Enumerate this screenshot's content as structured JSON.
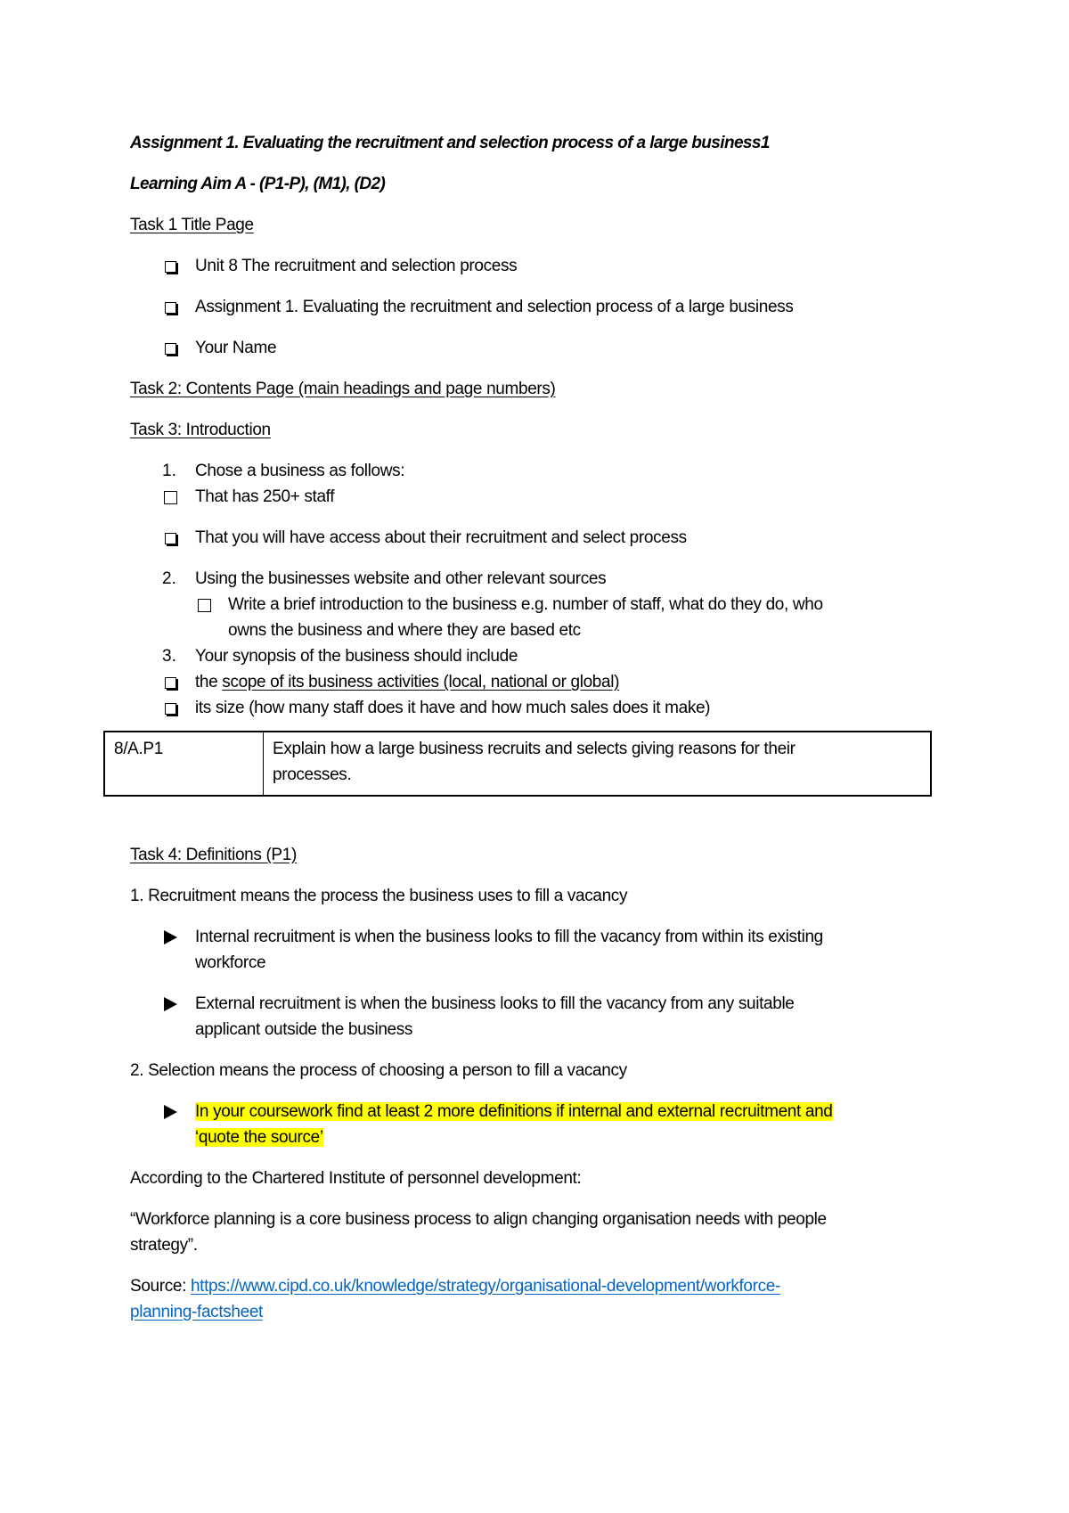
{
  "document": {
    "title": "Assignment 1.  Evaluating the recruitment and selection process of a large business1",
    "learning_aim": "Learning Aim A - (P1-P), (M1), (D2)",
    "task1": {
      "heading": "Task 1 Title Page ",
      "items": [
        "Unit 8 The recruitment and selection process",
        "Assignment 1.  Evaluating the recruitment and selection process of a large business",
        "Your Name"
      ]
    },
    "task2": {
      "heading": "Task 2: Contents Page (main headings and page numbers) "
    },
    "task3": {
      "heading": "Task 3: Introduction ",
      "step1_number": "1.",
      "step1_text": "Chose a business as follows:",
      "step1_items": [
        "That has 250+ staff",
        " That you will have access about their recruitment and select process"
      ],
      "step2_number": "2.",
      "step2_text": "Using the businesses website and other relevant sources",
      "step2_item_line1": "Write a brief introduction to the business e.g. number of staff, what do they do, who",
      "step2_item_line2": "owns the business and where they are based etc",
      "step3_number": "3.",
      "step3_text": "Your synopsis of the business should include",
      "step3_item1_prefix": "the ",
      "step3_item1_underlined": "scope of its business activities (local, national or global) ",
      "step3_item2": "its size (how many staff does it have and how much sales does it make)"
    },
    "criteria_table": {
      "rows": [
        {
          "code": "8/A.P1",
          "description_line1": "Explain how a large business recruits and selects giving reasons for their",
          "description_line2": "processes."
        }
      ]
    },
    "task4": {
      "heading": "Task 4: Definitions (P1)",
      "def1": "1. Recruitment means the process the business uses to fill a vacancy",
      "def1_bullets": [
        {
          "line1": "Internal recruitment is when the business looks to fill the vacancy from within its existing",
          "line2": "workforce"
        },
        {
          "line1": "External recruitment is when the business looks to fill the vacancy from any suitable",
          "line2": "applicant outside the business"
        }
      ],
      "def2": "2. Selection means the process of choosing a person to fill a vacancy",
      "highlight_line1": "In your coursework find at least 2 more definitions if internal and external recruitment and ",
      "highlight_line2": "‘quote the source’ ",
      "according_to": "According to the Chartered Institute of personnel development:",
      "quote_line1": "“Workforce planning is a core business process to align changing organisation needs with people",
      "quote_line2": "strategy”.",
      "source_label": "Source: ",
      "source_link_line1": "https://www.cipd.co.uk/knowledge/strategy/organisational-development/workforce-",
      "source_link_line2": "planning-factsheet"
    },
    "colors": {
      "highlight": "#ffff00",
      "link": "#0563c1"
    },
    "icons": {
      "checkbox_shadowed": "shadowed-square-bullet-icon",
      "checkbox_open": "open-square-bullet-icon",
      "triangle": "right-triangle-bullet-icon"
    }
  }
}
